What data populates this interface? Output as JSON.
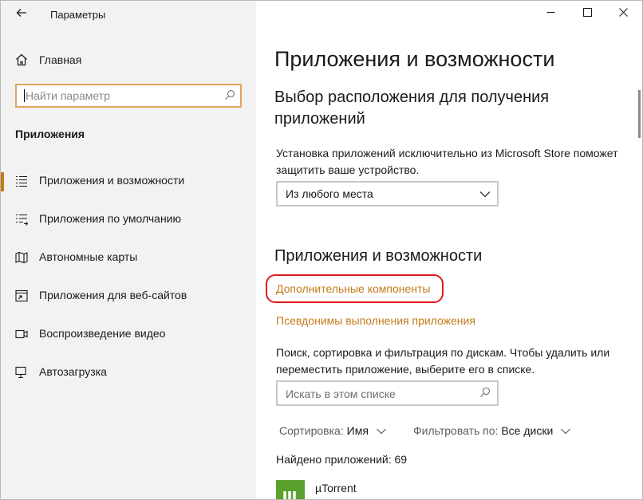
{
  "window": {
    "title": "Параметры",
    "controls": {
      "minimize_icon": "minimize-icon",
      "maximize_icon": "maximize-icon",
      "close_icon": "close-icon"
    }
  },
  "sidebar": {
    "home_label": "Главная",
    "search_placeholder": "Найти параметр",
    "section": "Приложения",
    "items": [
      {
        "label": "Приложения и возможности",
        "icon": "apps-list-icon",
        "active": true
      },
      {
        "label": "Приложения по умолчанию",
        "icon": "default-apps-icon"
      },
      {
        "label": "Автономные карты",
        "icon": "map-icon"
      },
      {
        "label": "Приложения для веб-сайтов",
        "icon": "web-apps-icon"
      },
      {
        "label": "Воспроизведение видео",
        "icon": "video-icon"
      },
      {
        "label": "Автозагрузка",
        "icon": "startup-icon"
      }
    ]
  },
  "main": {
    "title": "Приложения и возможности",
    "install_heading_line1": "Выбор расположения для получения",
    "install_heading_line2": "приложений",
    "install_desc_line1": "Установка приложений исключительно из Microsoft Store поможет",
    "install_desc_line2": "защитить ваше устройство.",
    "source_dropdown_value": "Из любого места",
    "apps_heading": "Приложения и возможности",
    "link_optional_features": "Дополнительные компоненты",
    "link_app_aliases": "Псевдонимы выполнения приложения",
    "search_desc_line1": "Поиск, сортировка и фильтрация по дискам. Чтобы удалить или",
    "search_desc_line2": "переместить приложение, выберите его в списке.",
    "list_search_placeholder": "Искать в этом списке",
    "sort_label": "Сортировка:",
    "sort_value": "Имя",
    "filter_label": "Фильтровать по:",
    "filter_value": "Все диски",
    "found_text": "Найдено приложений: 69",
    "apps": [
      {
        "name": "µTorrent",
        "icon": "utorrent-icon"
      }
    ]
  },
  "colors": {
    "accent": "#c47a1a",
    "search_focus_border": "#e3a35a",
    "highlight_ring": "#e0181b",
    "sidebar_bg": "#f2f2f2",
    "utorrent_green": "#5aa02c"
  }
}
